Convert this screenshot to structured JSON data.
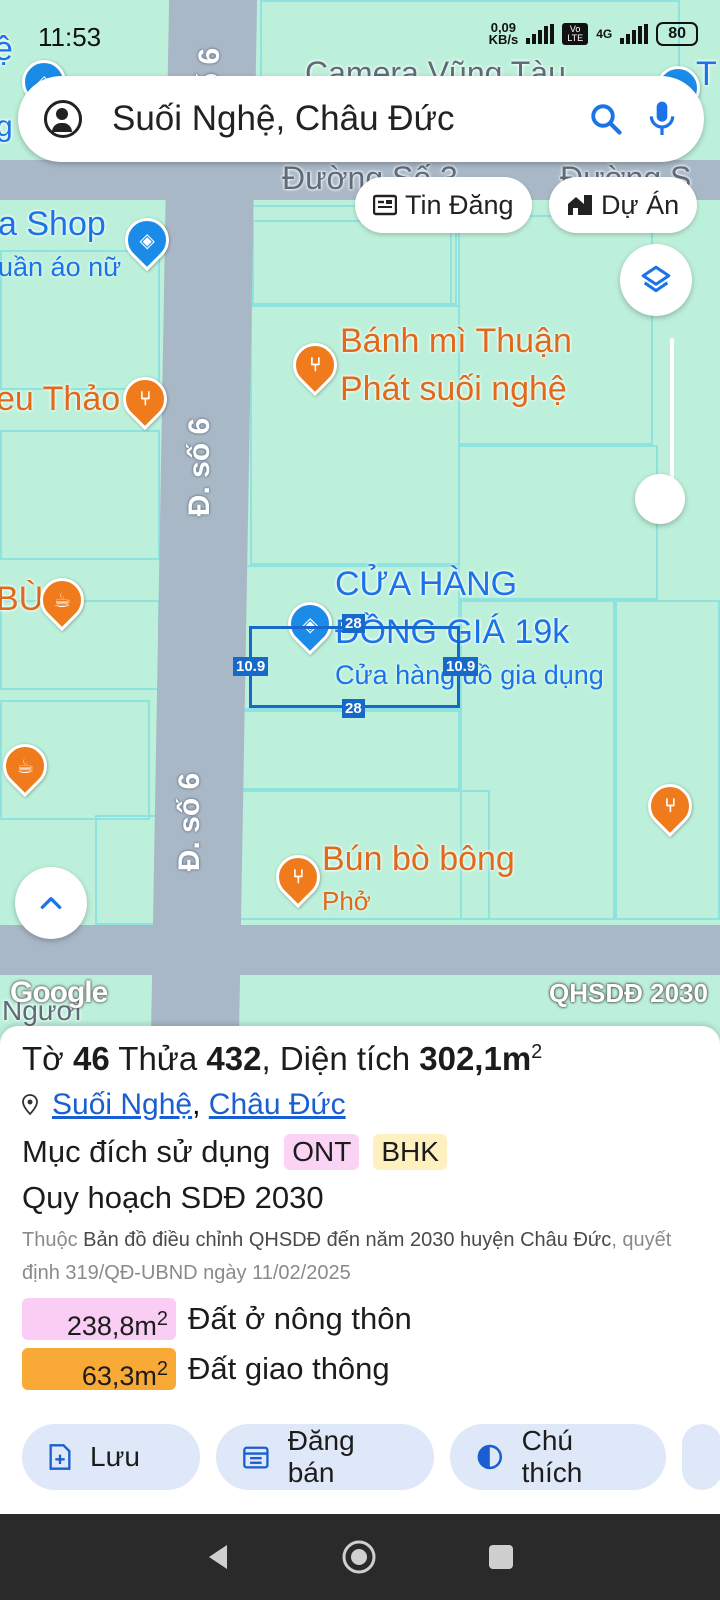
{
  "status_bar": {
    "time": "11:53",
    "net_speed_top": "0,09",
    "net_speed_bottom": "KB/s",
    "volte": "Vo LTE",
    "network": "4G",
    "battery": "80"
  },
  "search": {
    "query": "Suối Nghệ, Châu Đức"
  },
  "chips": {
    "listing": "Tin Đăng",
    "project": "Dự Án"
  },
  "map": {
    "edge_left_top": "ệ",
    "edge_left_top2": "g",
    "camera_label": "Camera Vũng Tàu",
    "edge_right_top": "T",
    "road_top": "Đường Số 3",
    "road_top2": "Đường S",
    "shop_name": "a Shop",
    "shop_sub": "uần áo nữ",
    "banh_mi": "Bánh mì Thuận",
    "banh_mi_2": "Phát suối nghệ",
    "eu_thao": "eu Thảo",
    "bu": "BÙ",
    "road_side_1": "Đ. số 6",
    "road_side_2": "Đ. số 6",
    "road_side_top": "Đ. số 6",
    "store_name_1": "CỬA HÀNG",
    "store_name_2": "ĐỒNG GIÁ 19k",
    "store_sub": "Cửa hàng đồ gia dụng",
    "bun_bo": "Bún bò bông",
    "pho": "Phở",
    "bottom_left_partial": "Ngươi",
    "google_logo": "Google",
    "overlay_label": "QHSDĐ 2030",
    "parcel_dims": {
      "top": "28",
      "bottom": "28",
      "left": "10.9",
      "right": "10.9"
    }
  },
  "parcel": {
    "line1_prefix": "Tờ",
    "sheet_no": "46",
    "line1_mid": "Thửa",
    "lot_no": "432",
    "area_label": ", Diện tích",
    "area": "302,1m",
    "area_unit_sup": "2",
    "location_commune": "Suối Nghệ",
    "location_sep": ",",
    "location_district": "Châu Đức",
    "purpose_label": "Mục đích sử dụng",
    "purpose_tags": [
      {
        "code": "ONT",
        "color": "#fbd3f4"
      },
      {
        "code": "BHK",
        "color": "#fff0c0"
      }
    ],
    "plan_title": "Quy hoạch SDĐ 2030",
    "desc_prefix": "Thuộc",
    "desc_doc": "Bản đồ điều chỉnh QHSDĐ đến năm 2030 huyện Châu Đức",
    "desc_suffix": ", quyết định 319/QĐ-UBND ngày 11/02/2025",
    "land_uses": [
      {
        "area": "238,8m",
        "sup": "2",
        "label": "Đất ở nông thôn",
        "color": "#f9cdf4"
      },
      {
        "area": "63,3m",
        "sup": "2",
        "label": "Đất giao thông",
        "color": "#f9a935"
      }
    ]
  },
  "actions": {
    "save": "Lưu",
    "post_sale": "Đăng bán",
    "legend": "Chú thích"
  },
  "colors": {
    "map_bg": "#bdf0da",
    "road": "#a9b8c7",
    "parcel_outline": "#1769c9",
    "accent_blue": "#1a73e8",
    "poi_orange": "#f07b1c"
  }
}
